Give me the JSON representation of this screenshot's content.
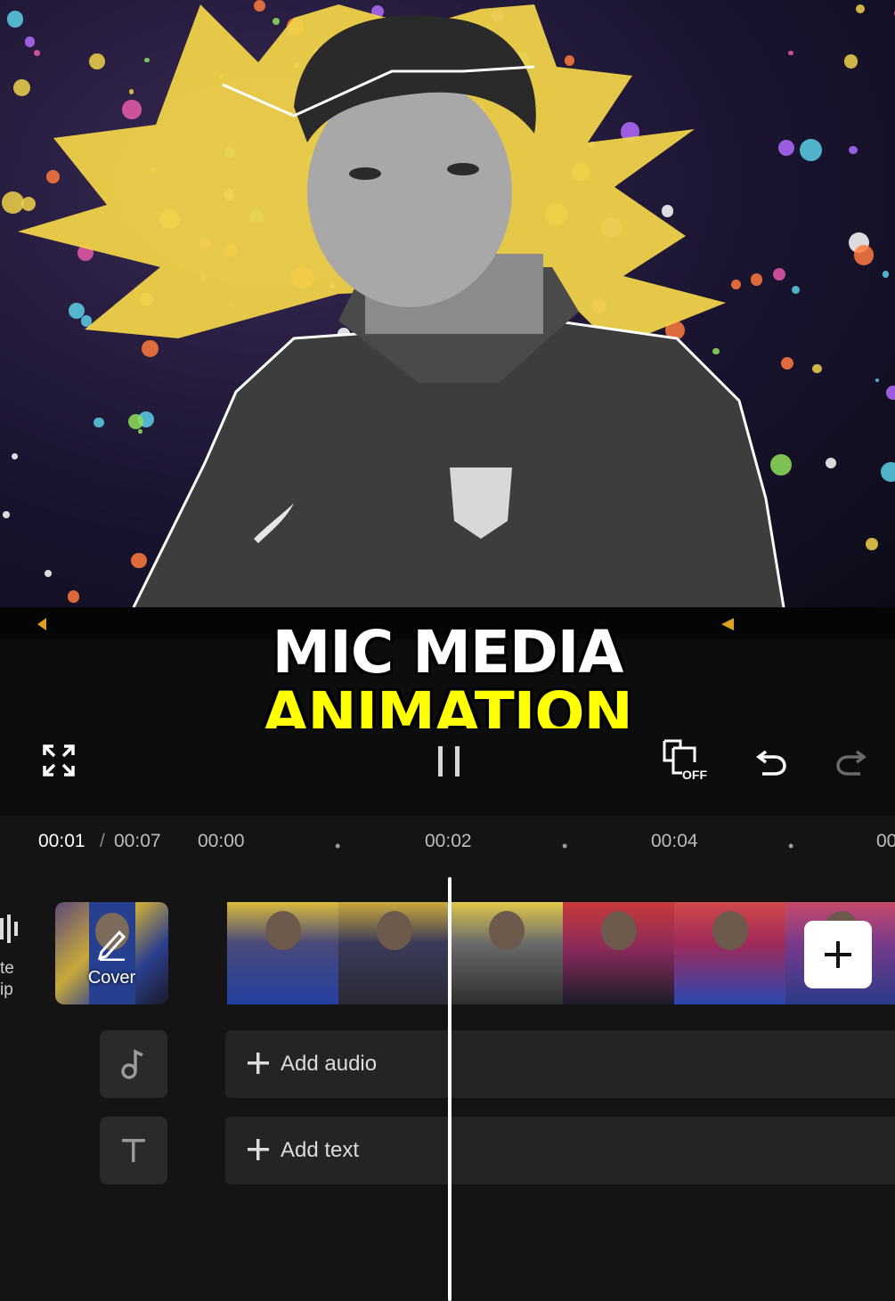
{
  "preview": {
    "description_icons": [
      "star-burst",
      "player-photo"
    ]
  },
  "overlay": {
    "title_line1": "MIC MEDIA",
    "title_line2": "ANIMATION",
    "title_line1_color": "#ffffff",
    "title_line2_color": "#ffff00"
  },
  "toolbar": {
    "fullscreen_icon": "fullscreen-icon",
    "pause_icon": "pause-icon",
    "keyframe_off_icon": "keyframe-off-icon",
    "keyframe_off_label": "OFF",
    "undo_icon": "undo-icon",
    "redo_icon": "redo-icon"
  },
  "timeline": {
    "current_time": "00:01",
    "separator": "/",
    "total_time": "00:07",
    "ruler": [
      "00:00",
      "00:02",
      "00:04",
      "00"
    ],
    "mute_label_line1": "te",
    "mute_label_line2": "ip",
    "cover_label": "Cover",
    "add_audio_label": "Add audio",
    "add_text_label": "Add text",
    "accent_white": "#ffffff",
    "track_bg": "#242424"
  }
}
